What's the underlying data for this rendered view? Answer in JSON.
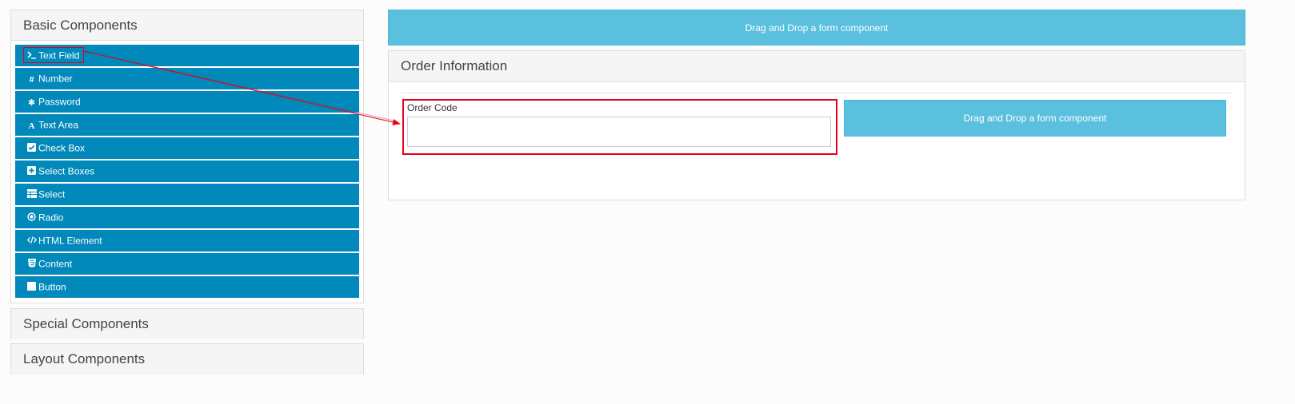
{
  "sidebar": {
    "basic_title": "Basic Components",
    "basic_items": [
      {
        "label": "Text Field",
        "icon": "terminal-icon"
      },
      {
        "label": "Number",
        "icon": "hashtag-icon"
      },
      {
        "label": "Password",
        "icon": "asterisk-icon"
      },
      {
        "label": "Text Area",
        "icon": "font-icon"
      },
      {
        "label": "Check Box",
        "icon": "check-square-icon"
      },
      {
        "label": "Select Boxes",
        "icon": "plus-square-icon"
      },
      {
        "label": "Select",
        "icon": "table-icon"
      },
      {
        "label": "Radio",
        "icon": "dot-circle-icon"
      },
      {
        "label": "HTML Element",
        "icon": "code-icon"
      },
      {
        "label": "Content",
        "icon": "html5-icon"
      },
      {
        "label": "Button",
        "icon": "stop-icon"
      }
    ],
    "special_title": "Special Components",
    "layout_title": "Layout Components"
  },
  "builder": {
    "dropzone_text": "Drag and Drop a form component",
    "fieldset_legend": "Order Information",
    "field": {
      "label": "Order Code",
      "value": ""
    },
    "column_dropzone_text": "Drag and Drop a form component"
  },
  "colors": {
    "component_bg": "#0089ba",
    "dropzone_bg": "#5bc0de",
    "annotation_red": "#e3001b"
  }
}
